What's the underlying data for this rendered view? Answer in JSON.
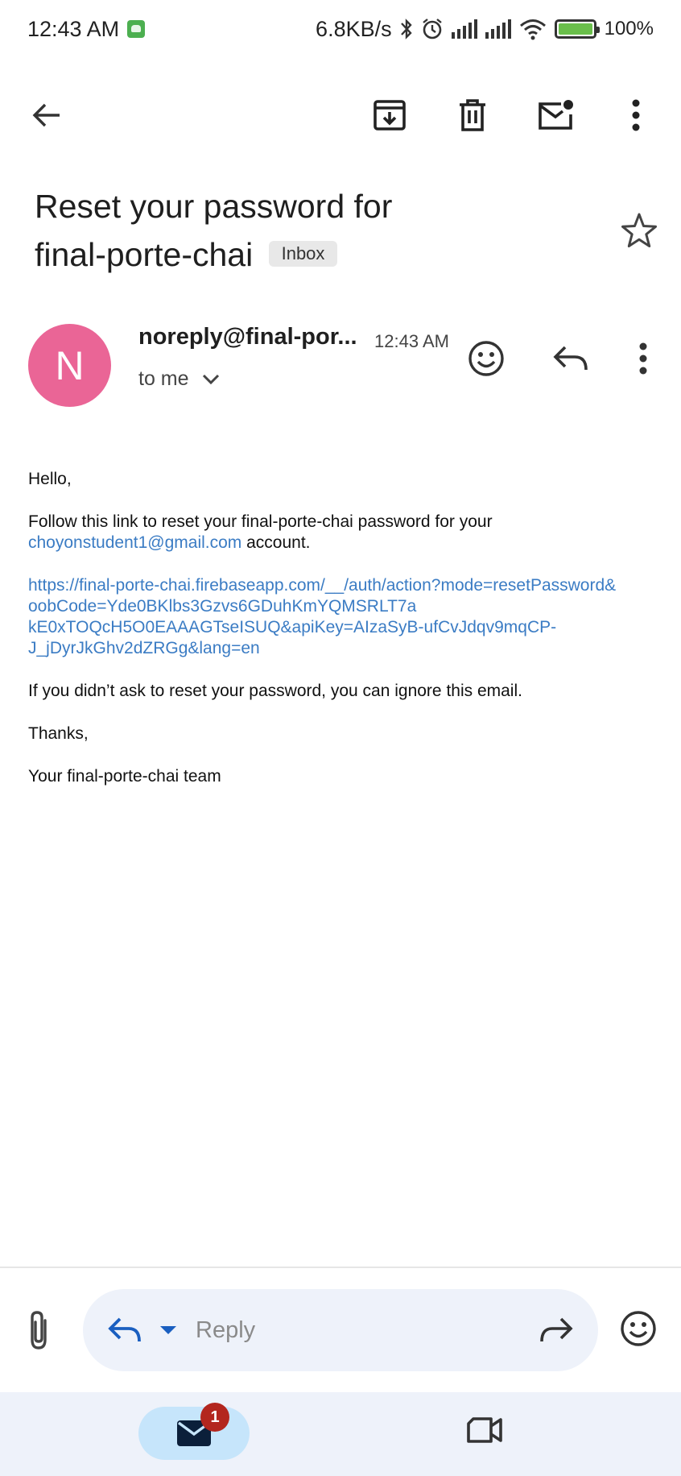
{
  "status_bar": {
    "time": "12:43 AM",
    "net_speed": "6.8KB/s",
    "battery": "100%"
  },
  "toolbar": {
    "back_icon": "arrow-left-icon",
    "archive_icon": "archive-icon",
    "delete_icon": "trash-icon",
    "mark_unread_icon": "mail-unread-icon",
    "more_icon": "more-vert-icon"
  },
  "email": {
    "subject_line1": "Reset your password for",
    "subject_line2": "final-porte-chai",
    "label": "Inbox",
    "sender_initial": "N",
    "sender_name": "noreply@final-por...",
    "time": "12:43 AM",
    "recipient": "to me",
    "greeting": "Hello,",
    "intro_text": "Follow this link to reset your final-porte-chai password for your",
    "account_email": "choyonstudent1@gmail.com",
    "account_suffix": " account.",
    "reset_link_lines": [
      "https://final-porte-chai.firebaseapp.com/__/auth/action?mode=resetPassword&",
      "oobCode=Yde0BKlbs3Gzvs6GDuhKmYQMSRLT7a",
      "kE0xTOQcH5O0EAAAGTseISUQ&apiKey=AIzaSyB-ufCvJdqv9mqCP-",
      "J_jDyrJkGhv2dZRGg&lang=en"
    ],
    "ignore_text": "If you didn’t ask to reset your password, you can ignore this email.",
    "thanks": "Thanks,",
    "signature": "Your final-porte-chai team"
  },
  "reply_bar": {
    "placeholder": "Reply"
  },
  "bottom_nav": {
    "mail_badge_count": "1"
  },
  "colors": {
    "avatar": "#ea6596",
    "link": "#3b7cc4",
    "reply_icon": "#1a5fc0",
    "badge": "#b3261e",
    "nav_bg": "#eef2fa",
    "active_tab": "#c6e5fb"
  }
}
